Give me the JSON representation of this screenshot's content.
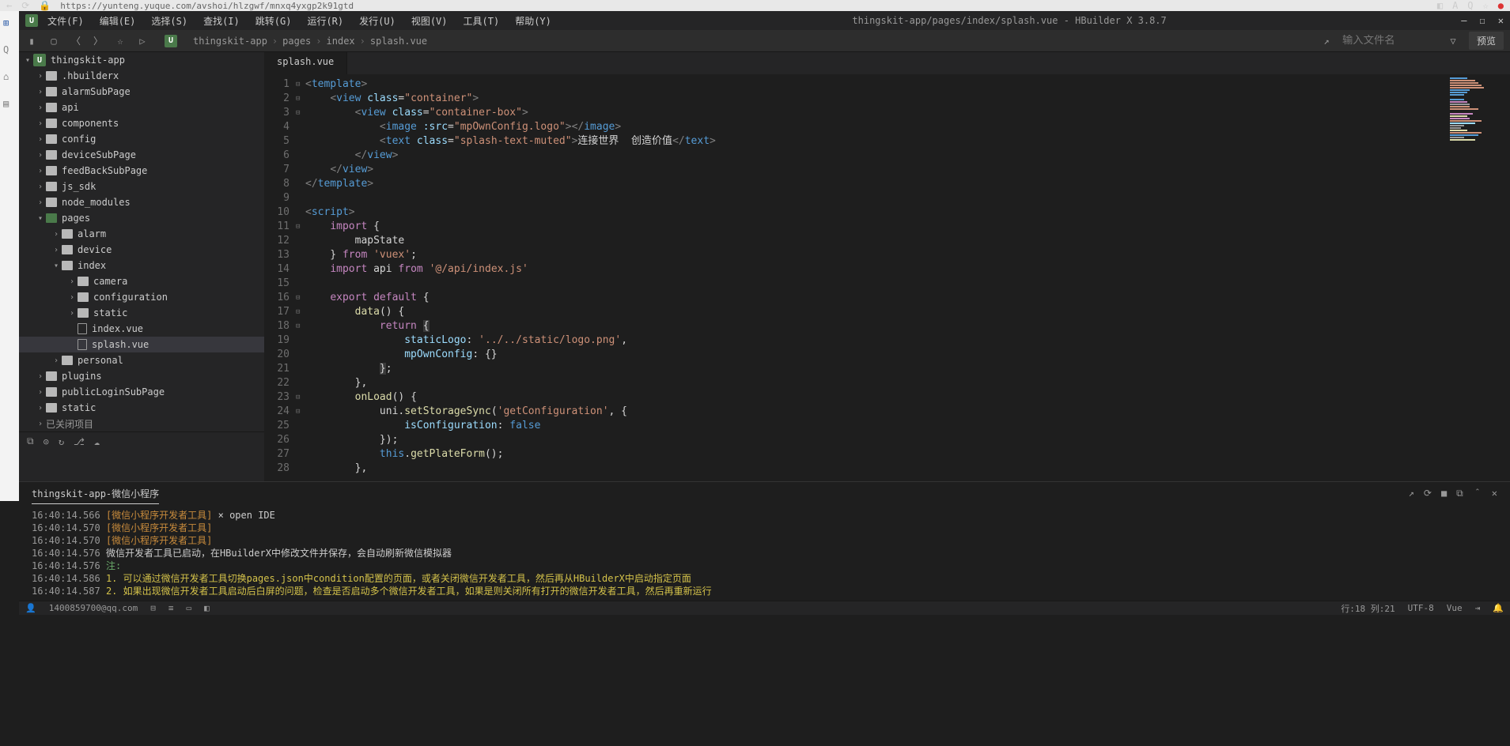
{
  "browser": {
    "url": "https://yunteng.yuque.com/avshoi/hlzgwf/mnxq4yxgp2k91gtd"
  },
  "menubar": {
    "file": "文件(F)",
    "edit": "编辑(E)",
    "select": "选择(S)",
    "find": "查找(I)",
    "goto": "跳转(G)",
    "run": "运行(R)",
    "publish": "发行(U)",
    "view": "视图(V)",
    "tool": "工具(T)",
    "help": "帮助(Y)",
    "title": "thingskit-app/pages/index/splash.vue - HBuilder X 3.8.7"
  },
  "breadcrumb": {
    "a": "thingskit-app",
    "b": "pages",
    "c": "index",
    "d": "splash.vue"
  },
  "toolbar": {
    "search_placeholder": "输入文件名",
    "preview": "预览"
  },
  "tree": {
    "root": "thingskit-app",
    "hbuilderx": ".hbuilderx",
    "alarmSubPage": "alarmSubPage",
    "api": "api",
    "components": "components",
    "config": "config",
    "deviceSubPage": "deviceSubPage",
    "feedBackSubPage": "feedBackSubPage",
    "js_sdk": "js_sdk",
    "node_modules": "node_modules",
    "pages": "pages",
    "alarm": "alarm",
    "device": "device",
    "index": "index",
    "camera": "camera",
    "configuration": "configuration",
    "static": "static",
    "indexvue": "index.vue",
    "splashvue": "splash.vue",
    "personal": "personal",
    "plugins": "plugins",
    "publicLoginSubPage": "publicLoginSubPage",
    "static2": "static",
    "closed": "已关闭项目"
  },
  "tab": {
    "name": "splash.vue"
  },
  "code": {
    "l1": {
      "tag": "template"
    },
    "l2": {
      "tag": "view",
      "cls": "container"
    },
    "l3": {
      "tag": "view",
      "cls": "container-box"
    },
    "l4": {
      "tag": "image",
      "attr": ":src",
      "val": "mpOwnConfig.logo"
    },
    "l5": {
      "tag": "text",
      "cls": "splash-text-muted",
      "text": "连接世界  创造价值"
    },
    "l6": {
      "tag": "view"
    },
    "l7": {
      "tag": "view"
    },
    "l8": {
      "tag": "template"
    },
    "l10": {
      "tag": "script"
    },
    "l11": {
      "kw": "import"
    },
    "l12": {
      "id": "mapState"
    },
    "l13": {
      "kw": "from",
      "str": "'vuex'"
    },
    "l14": {
      "kw1": "import",
      "id": "api",
      "kw2": "from",
      "str": "'@/api/index.js'"
    },
    "l16": {
      "kw1": "export",
      "kw2": "default"
    },
    "l17": {
      "fn": "data"
    },
    "l18": {
      "kw": "return"
    },
    "l19": {
      "prop": "staticLogo",
      "str": "'../../static/logo.png'"
    },
    "l20": {
      "prop": "mpOwnConfig"
    },
    "l23": {
      "fn": "onLoad"
    },
    "l24a": "uni",
    "l24b": "setStorageSync",
    "l24c": "'getConfiguration'",
    "l25": {
      "prop": "isConfiguration",
      "val": "false"
    },
    "l27a": "this",
    "l27b": "getPlateForm"
  },
  "console": {
    "tab": "thingskit-app-微信小程序",
    "l1": {
      "t": "16:40:14.566",
      "tag": "[微信小程序开发者工具]",
      "txt": " × open IDE"
    },
    "l2": {
      "t": "16:40:14.570",
      "tag": "[微信小程序开发者工具]"
    },
    "l3": {
      "t": "16:40:14.570",
      "tag": "[微信小程序开发者工具]"
    },
    "l4": {
      "t": "16:40:14.576",
      "txt": "微信开发者工具已启动，在HBuilderX中修改文件并保存，会自动刷新微信模拟器"
    },
    "l5": {
      "t": "16:40:14.576",
      "txt": "注:"
    },
    "l6": {
      "t": "16:40:14.586",
      "txt": "1. 可以通过微信开发者工具切换pages.json中condition配置的页面，或者关闭微信开发者工具，然后再从HBuilderX中启动指定页面"
    },
    "l7": {
      "t": "16:40:14.587",
      "txt": "2. 如果出现微信开发者工具启动后白屏的问题，检查是否启动多个微信开发者工具，如果是则关闭所有打开的微信开发者工具，然后再重新运行"
    }
  },
  "status": {
    "user": "1400859700@qq.com",
    "pos": "行:18  列:21",
    "enc": "UTF-8",
    "lang": "Vue"
  }
}
